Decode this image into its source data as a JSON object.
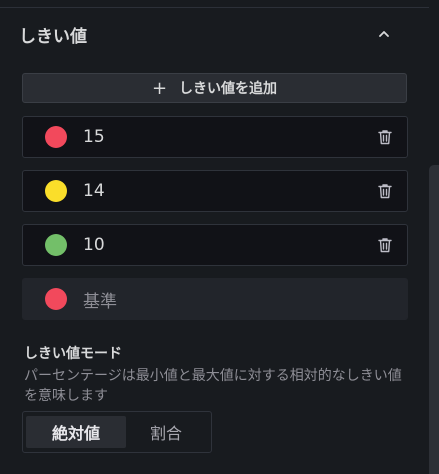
{
  "section": {
    "title": "しきい値",
    "chevron_icon": "chevron-up-icon"
  },
  "add_button": {
    "icon": "plus-icon",
    "label": "しきい値を追加"
  },
  "thresholds": [
    {
      "value": "15",
      "color": "#f2495c",
      "delete_icon": "trash-icon"
    },
    {
      "value": "14",
      "color": "#fade2a",
      "delete_icon": "trash-icon"
    },
    {
      "value": "10",
      "color": "#73bf69",
      "delete_icon": "trash-icon"
    }
  ],
  "base": {
    "label": "基準",
    "color": "#f2495c"
  },
  "mode": {
    "title": "しきい値モード",
    "description": "パーセンテージは最小値と最大値に対する相対的なしきい値を意味します",
    "options": [
      {
        "label": "絶対値",
        "selected": true
      },
      {
        "label": "割合",
        "selected": false
      }
    ]
  }
}
